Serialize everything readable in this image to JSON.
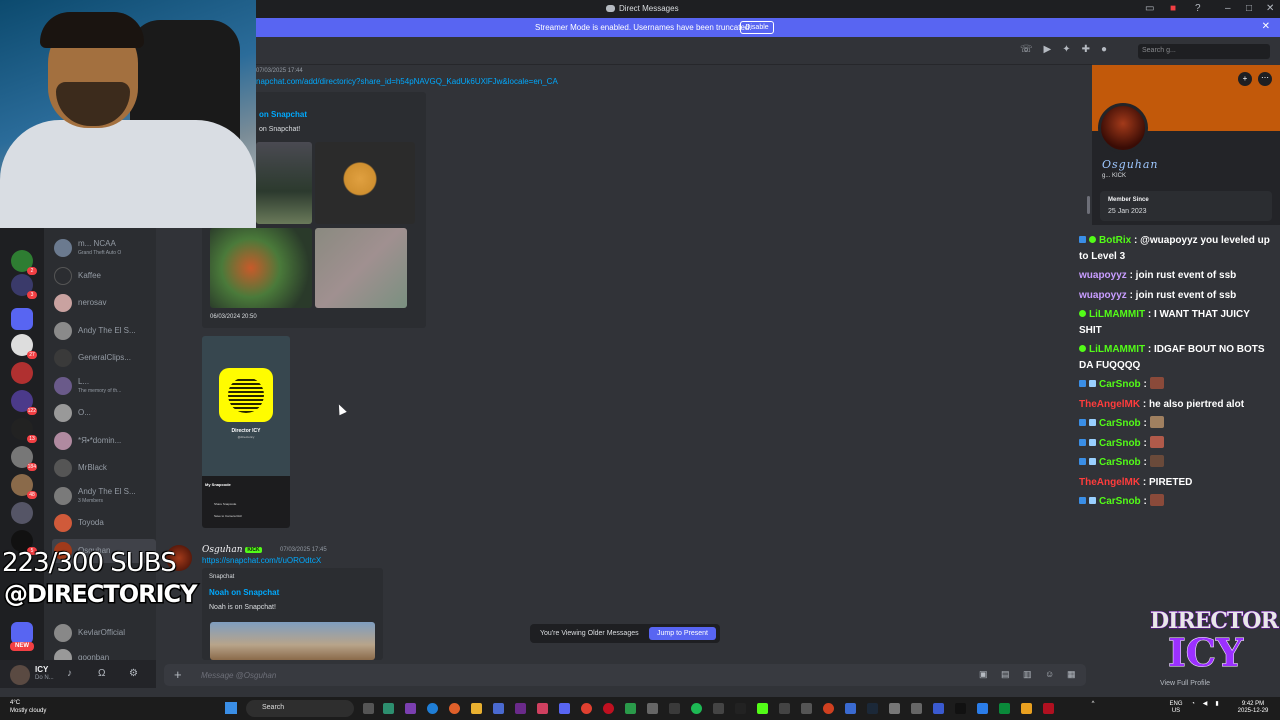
{
  "window": {
    "title": "Direct Messages"
  },
  "streamer_bar": {
    "message": "Streamer Mode is enabled. Usernames have been truncated.",
    "disable_label": "Disable"
  },
  "header": {
    "search_placeholder": "Search g..."
  },
  "overlay": {
    "subs": "223/300 SUBS",
    "handle": "@DIRECTORICY"
  },
  "guild_badges": [
    "2",
    "3",
    "27",
    "122",
    "13",
    "184",
    "48",
    "5"
  ],
  "new_badge": "NEW",
  "dm_list": [
    {
      "name": "m...  NCAA",
      "sub": "Grand Theft Auto O",
      "color": "#6b7a8f"
    },
    {
      "name": "Kaffee",
      "sub": "",
      "color": "#2b2d31"
    },
    {
      "name": "nerosav",
      "sub": "",
      "color": "#c9a2a0"
    },
    {
      "name": "Andy The El S...",
      "sub": "",
      "color": "#8a8a8a"
    },
    {
      "name": "GeneralClips...",
      "sub": "",
      "color": "#3a3a3a"
    },
    {
      "name": "L...",
      "sub": "The memory of th...",
      "color": "#6a5a8a"
    },
    {
      "name": "O...",
      "sub": "",
      "color": "#999999"
    },
    {
      "name": "*Я•*domin...",
      "sub": "",
      "color": "#b08aa0"
    },
    {
      "name": "MrBlack",
      "sub": "",
      "color": "#555555"
    },
    {
      "name": "Andy The El S...",
      "sub": "3 Members",
      "color": "#7a7a7a"
    },
    {
      "name": "Toyoda",
      "sub": "",
      "color": "#d05a3a"
    },
    {
      "name": "Osguhan",
      "sub": "",
      "color": "#a03a1a"
    },
    {
      "name": "KevlarOfficial",
      "sub": "",
      "color": "#888888"
    },
    {
      "name": "goonban",
      "sub": "",
      "color": "#999999"
    }
  ],
  "user_panel": {
    "name": "ICY",
    "status": "Do N..."
  },
  "messages": {
    "first_time": "07/03/2025 17:44",
    "first_link": "napchat.com/add/directoricy?share_id=h54pNAVGQ_KadUk6UXlFJw&locale=en_CA",
    "first_embed_title": "on Snapchat",
    "first_embed_desc": "on Snapchat!",
    "first_embed_date": "06/03/2024 20:50",
    "snapcode_name": "Director ICY",
    "snapcode_sub": "@directoricy",
    "snapcode_menu_title": "My Snapcode",
    "snapcode_menu_1": "Share Snapcode",
    "snapcode_menu_2": "Save to Camera Roll",
    "second_author": "Osguhan",
    "second_badge": "KICK",
    "second_time": "07/03/2025 17:45",
    "second_link": "https://snapchat.com/t/uOROdtcX",
    "second_embed_provider": "Snapchat",
    "second_embed_title": "Noah on Snapchat",
    "second_embed_desc": "Noah is on Snapchat!"
  },
  "older_banner": {
    "text": "You're Viewing Older Messages",
    "jump_label": "Jump to Present"
  },
  "composer": {
    "placeholder": "Message @Osguhan"
  },
  "profile": {
    "name": "Osguhan",
    "status": "g...  KICK",
    "member_since_label": "Member Since",
    "member_since_value": "25 Jan 2023",
    "view_full": "View Full Profile"
  },
  "kick_chat": [
    {
      "user": "BotRix",
      "text": " : @wuapoyyz you leveled up to Level 3",
      "color": "#53fc18"
    },
    {
      "user": "wuapoyyz",
      "text": " : join rust event of ssb",
      "color": "#c89dff"
    },
    {
      "user": "wuapoyyz",
      "text": " : join rust event of ssb",
      "color": "#c89dff"
    },
    {
      "user": "LiLMAMMIT",
      "text": " : I WANT THAT JUICY SHIT",
      "color": "#53fc18"
    },
    {
      "user": "LiLMAMMIT",
      "text": " : IDGAF BOUT NO BOTS DA FUQQQQ",
      "color": "#53fc18"
    },
    {
      "user": "CarSnob",
      "text": " : ",
      "color": "#53fc18"
    },
    {
      "user": "TheAngelMK",
      "text": " : he also piertred alot",
      "color": "#ff3c3c"
    },
    {
      "user": "CarSnob",
      "text": " : ",
      "color": "#53fc18"
    },
    {
      "user": "CarSnob",
      "text": " : ",
      "color": "#53fc18"
    },
    {
      "user": "CarSnob",
      "text": " : ",
      "color": "#53fc18"
    },
    {
      "user": "TheAngelMK",
      "text": " : PIRETED",
      "color": "#ff3c3c"
    },
    {
      "user": "CarSnob",
      "text": " : ",
      "color": "#53fc18"
    }
  ],
  "watermark": {
    "line1": "DIRECTOR",
    "line2": "ICY"
  },
  "taskbar": {
    "weather_temp": "4°C",
    "weather_desc": "Mostly cloudy",
    "search": "Search",
    "lang1": "ENG",
    "lang2": "US",
    "time": "9:42 PM",
    "date": "2025-12-29"
  }
}
